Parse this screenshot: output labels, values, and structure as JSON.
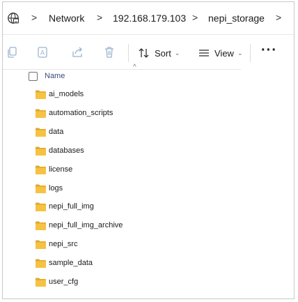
{
  "address": {
    "crumbs": [
      "Network",
      "192.168.179.103",
      "nepi_storage"
    ],
    "separator": ">"
  },
  "toolbar": {
    "sort_label": "Sort",
    "view_label": "View",
    "more_label": "···",
    "caret": "⌄"
  },
  "header": {
    "name_label": "Name",
    "sort_indicator": "^"
  },
  "items": [
    {
      "name": "ai_models"
    },
    {
      "name": "automation_scripts"
    },
    {
      "name": "data"
    },
    {
      "name": "databases"
    },
    {
      "name": "license"
    },
    {
      "name": "logs"
    },
    {
      "name": "nepi_full_img"
    },
    {
      "name": "nepi_full_img_archive"
    },
    {
      "name": "nepi_src"
    },
    {
      "name": "sample_data"
    },
    {
      "name": "user_cfg"
    }
  ],
  "colors": {
    "folder": "#f5c242",
    "folder_dark": "#e0a82e",
    "icon_disabled": "#9bb3cf",
    "text": "#1a1a1a"
  }
}
